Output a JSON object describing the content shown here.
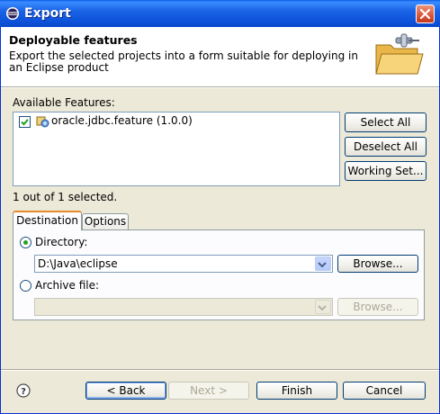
{
  "window": {
    "title": "Export"
  },
  "banner": {
    "title": "Deployable features",
    "description": "Export the selected projects into a form suitable for deploying in an Eclipse product"
  },
  "features": {
    "label": "Available Features:",
    "items": [
      {
        "label": "oracle.jdbc.feature (1.0.0)",
        "checked": true
      }
    ],
    "status": "1 out of 1 selected.",
    "buttons": {
      "select_all": "Select All",
      "deselect_all": "Deselect All",
      "working_set": "Working Set..."
    }
  },
  "tabs": [
    {
      "label": "Destination",
      "active": true
    },
    {
      "label": "Options",
      "active": false
    }
  ],
  "destination": {
    "directory_label": "Directory:",
    "directory_selected": true,
    "directory_value": "D:\\Java\\eclipse",
    "browse_label": "Browse...",
    "archive_label": "Archive file:",
    "archive_selected": false,
    "archive_value": "",
    "archive_browse_label": "Browse..."
  },
  "footer": {
    "back": "< Back",
    "next": "Next >",
    "finish": "Finish",
    "cancel": "Cancel"
  },
  "colors": {
    "titlebar": "#0b4ed6",
    "dialog_bg": "#ece9d8",
    "tab_accent": "#e68b2c",
    "radio_dot": "#21a121"
  }
}
